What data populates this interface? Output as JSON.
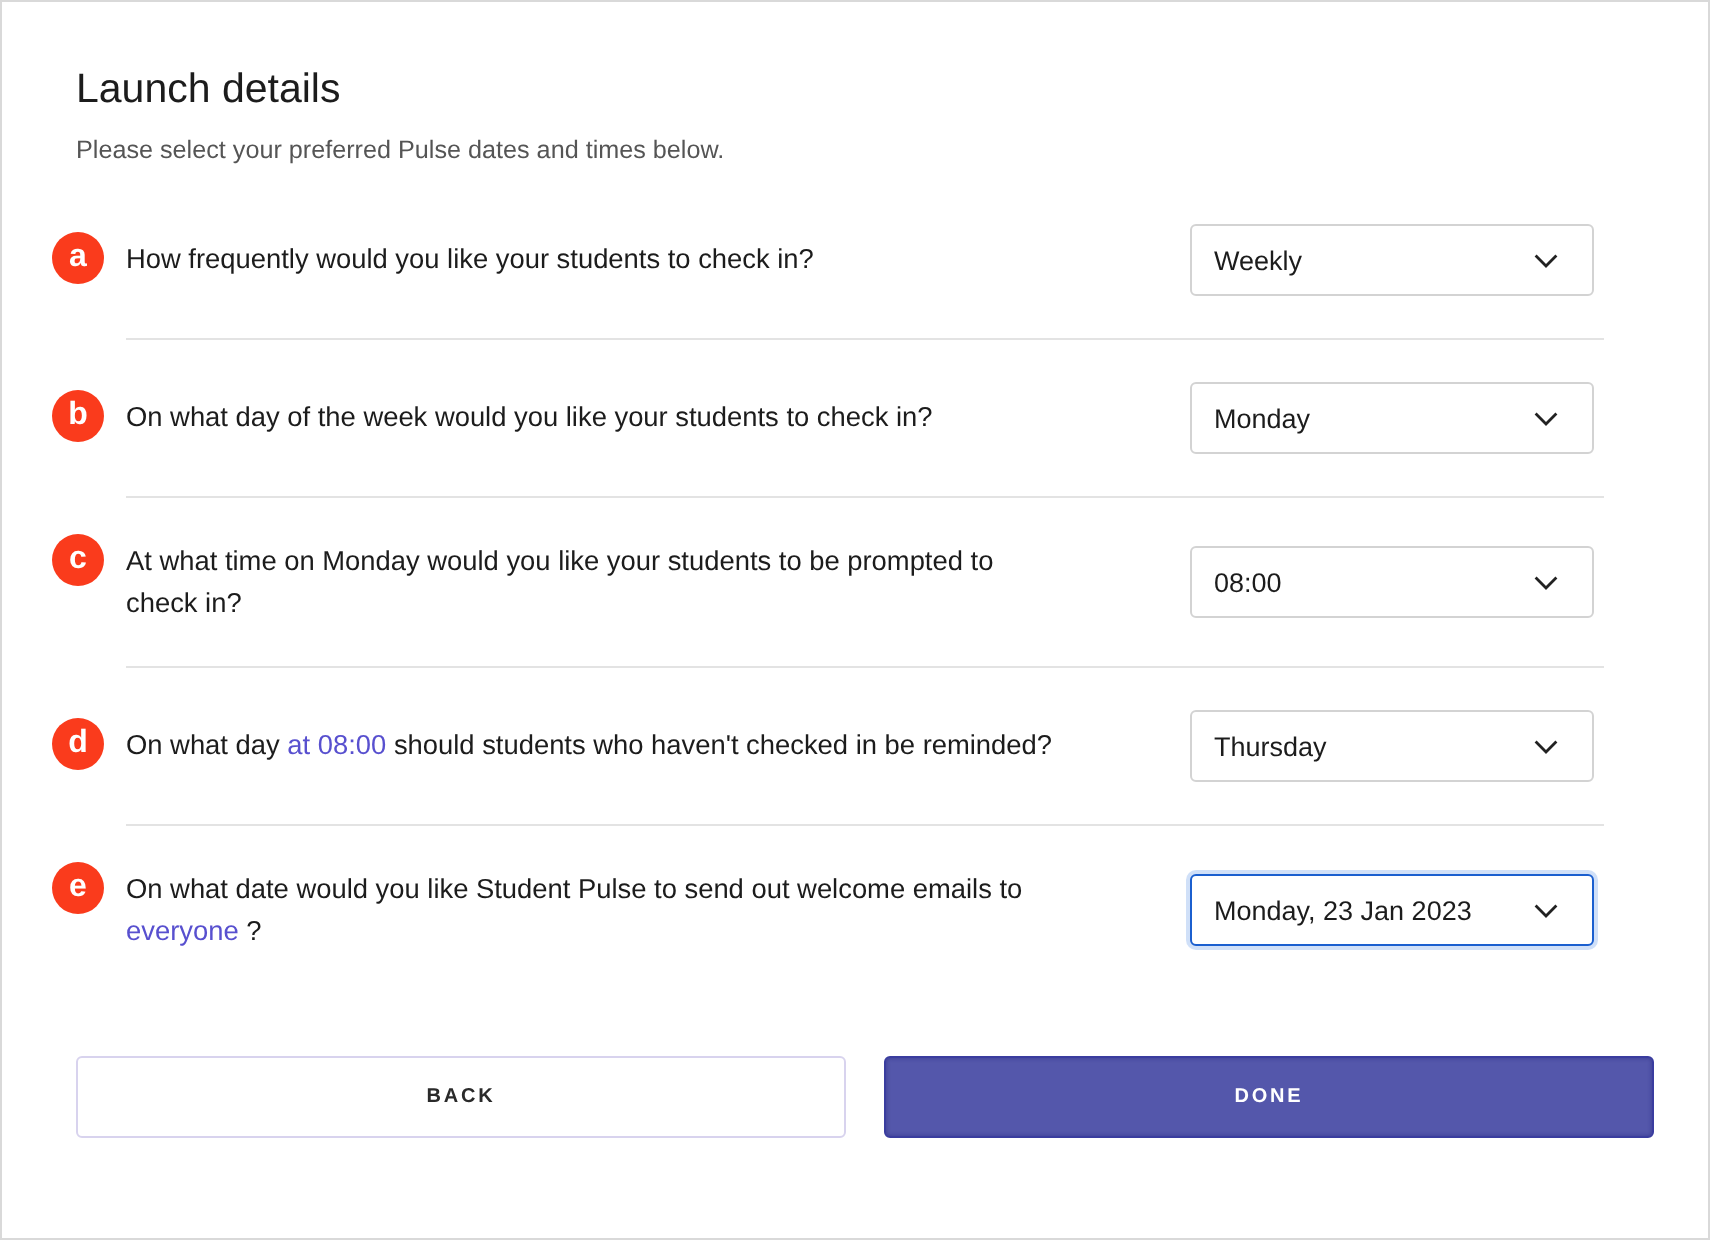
{
  "header": {
    "title": "Launch details",
    "subtitle": "Please select your preferred Pulse dates and times below."
  },
  "questions": [
    {
      "marker": "a",
      "parts": [
        {
          "kind": "plain",
          "text": "How frequently would you like your students to check in?"
        }
      ],
      "field": {
        "value": "Weekly",
        "focused": false
      }
    },
    {
      "marker": "b",
      "parts": [
        {
          "kind": "plain",
          "text": "On what day of the week would you like your students to check in?"
        }
      ],
      "field": {
        "value": "Monday",
        "focused": false
      }
    },
    {
      "marker": "c",
      "parts": [
        {
          "kind": "plain",
          "text": "At what time on Monday would you like your students to be prompted to check in?"
        }
      ],
      "field": {
        "value": "08:00",
        "focused": false
      }
    },
    {
      "marker": "d",
      "parts": [
        {
          "kind": "plain",
          "text": "On what day "
        },
        {
          "kind": "highlight",
          "text": "at 08:00"
        },
        {
          "kind": "plain",
          "text": " should students who haven't checked in be reminded?"
        }
      ],
      "field": {
        "value": "Thursday",
        "focused": false
      }
    },
    {
      "marker": "e",
      "parts": [
        {
          "kind": "plain",
          "text": "On what date would you like Student Pulse to send out welcome emails to "
        },
        {
          "kind": "highlight",
          "text": "everyone"
        },
        {
          "kind": "plain",
          "text": " ?"
        }
      ],
      "field": {
        "value": "Monday, 23 Jan 2023",
        "focused": true
      }
    }
  ],
  "buttons": [
    {
      "label": "BACK",
      "kind": "secondary"
    },
    {
      "label": "DONE",
      "kind": "primary"
    }
  ]
}
